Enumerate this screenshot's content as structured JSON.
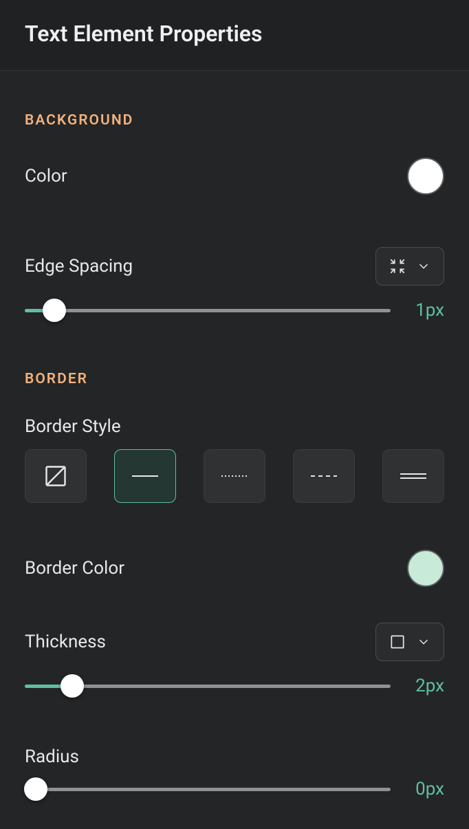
{
  "header": {
    "title": "Text Element Properties"
  },
  "background": {
    "section_label": "BACKGROUND",
    "color_label": "Color",
    "color_value": "#ffffff",
    "edge_spacing_label": "Edge Spacing",
    "edge_spacing_value": "1px",
    "edge_spacing_pct": 8
  },
  "border": {
    "section_label": "BORDER",
    "style_label": "Border Style",
    "styles": [
      "none",
      "solid",
      "dotted",
      "dashed",
      "double"
    ],
    "selected_style": "solid",
    "color_label": "Border Color",
    "color_value": "#c7ead9",
    "thickness_label": "Thickness",
    "thickness_value": "2px",
    "thickness_pct": 13,
    "radius_label": "Radius",
    "radius_value": "0px",
    "radius_pct": 0
  }
}
